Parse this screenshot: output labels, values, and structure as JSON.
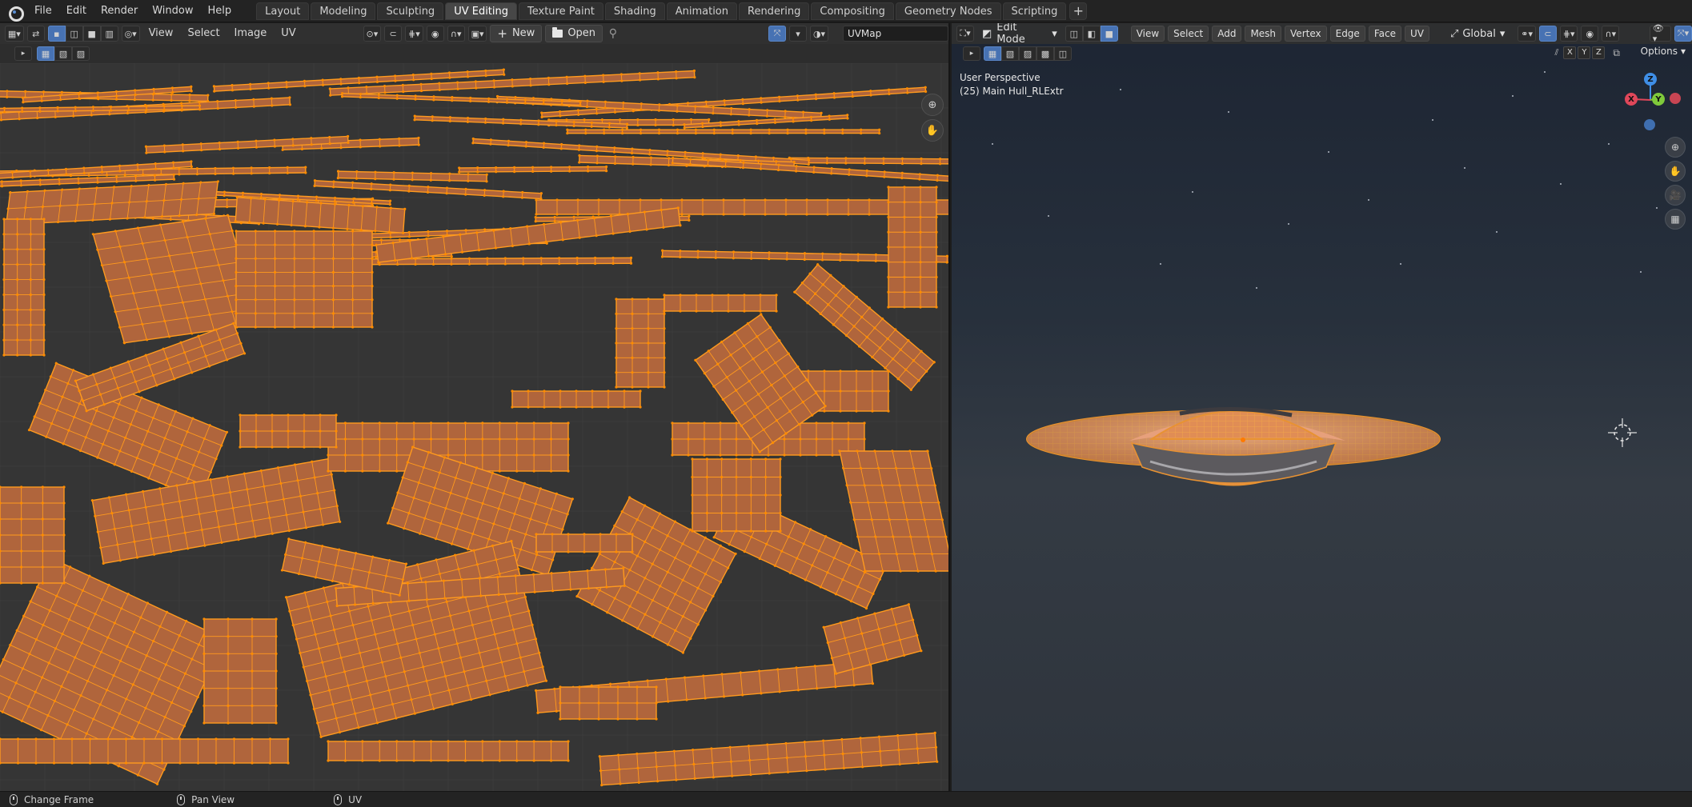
{
  "topbar": {
    "menus": [
      "File",
      "Edit",
      "Render",
      "Window",
      "Help"
    ],
    "workspace_tabs": [
      "Layout",
      "Modeling",
      "Sculpting",
      "UV Editing",
      "Texture Paint",
      "Shading",
      "Animation",
      "Rendering",
      "Compositing",
      "Geometry Nodes",
      "Scripting"
    ],
    "active_tab": "UV Editing",
    "add_tab": "+"
  },
  "uv_editor": {
    "menus": [
      "View",
      "Select",
      "Image",
      "UV"
    ],
    "new_label": "New",
    "open_label": "Open",
    "uv_map_name": "UVMap",
    "island_color": "#b0653c",
    "edge_color": "#ff9a1e",
    "background_color": "#353535"
  },
  "viewport": {
    "mode": "Edit Mode",
    "menus": [
      "View",
      "Select",
      "Add",
      "Mesh",
      "Vertex",
      "Edge",
      "Face",
      "UV"
    ],
    "transform_orientation": "Global",
    "perspective_label": "User Perspective",
    "object_label": "(25) Main Hull_RLExtr",
    "axis_toggles": [
      "X",
      "Y",
      "Z"
    ],
    "options_label": "Options",
    "gizmo_axes": [
      "X",
      "Y",
      "Z"
    ],
    "axis_colors": {
      "x": "#e0475a",
      "y": "#7fc93b",
      "z": "#3f8ee6"
    }
  },
  "statusbar": {
    "items": [
      "Change Frame",
      "Pan View",
      "UV"
    ]
  }
}
